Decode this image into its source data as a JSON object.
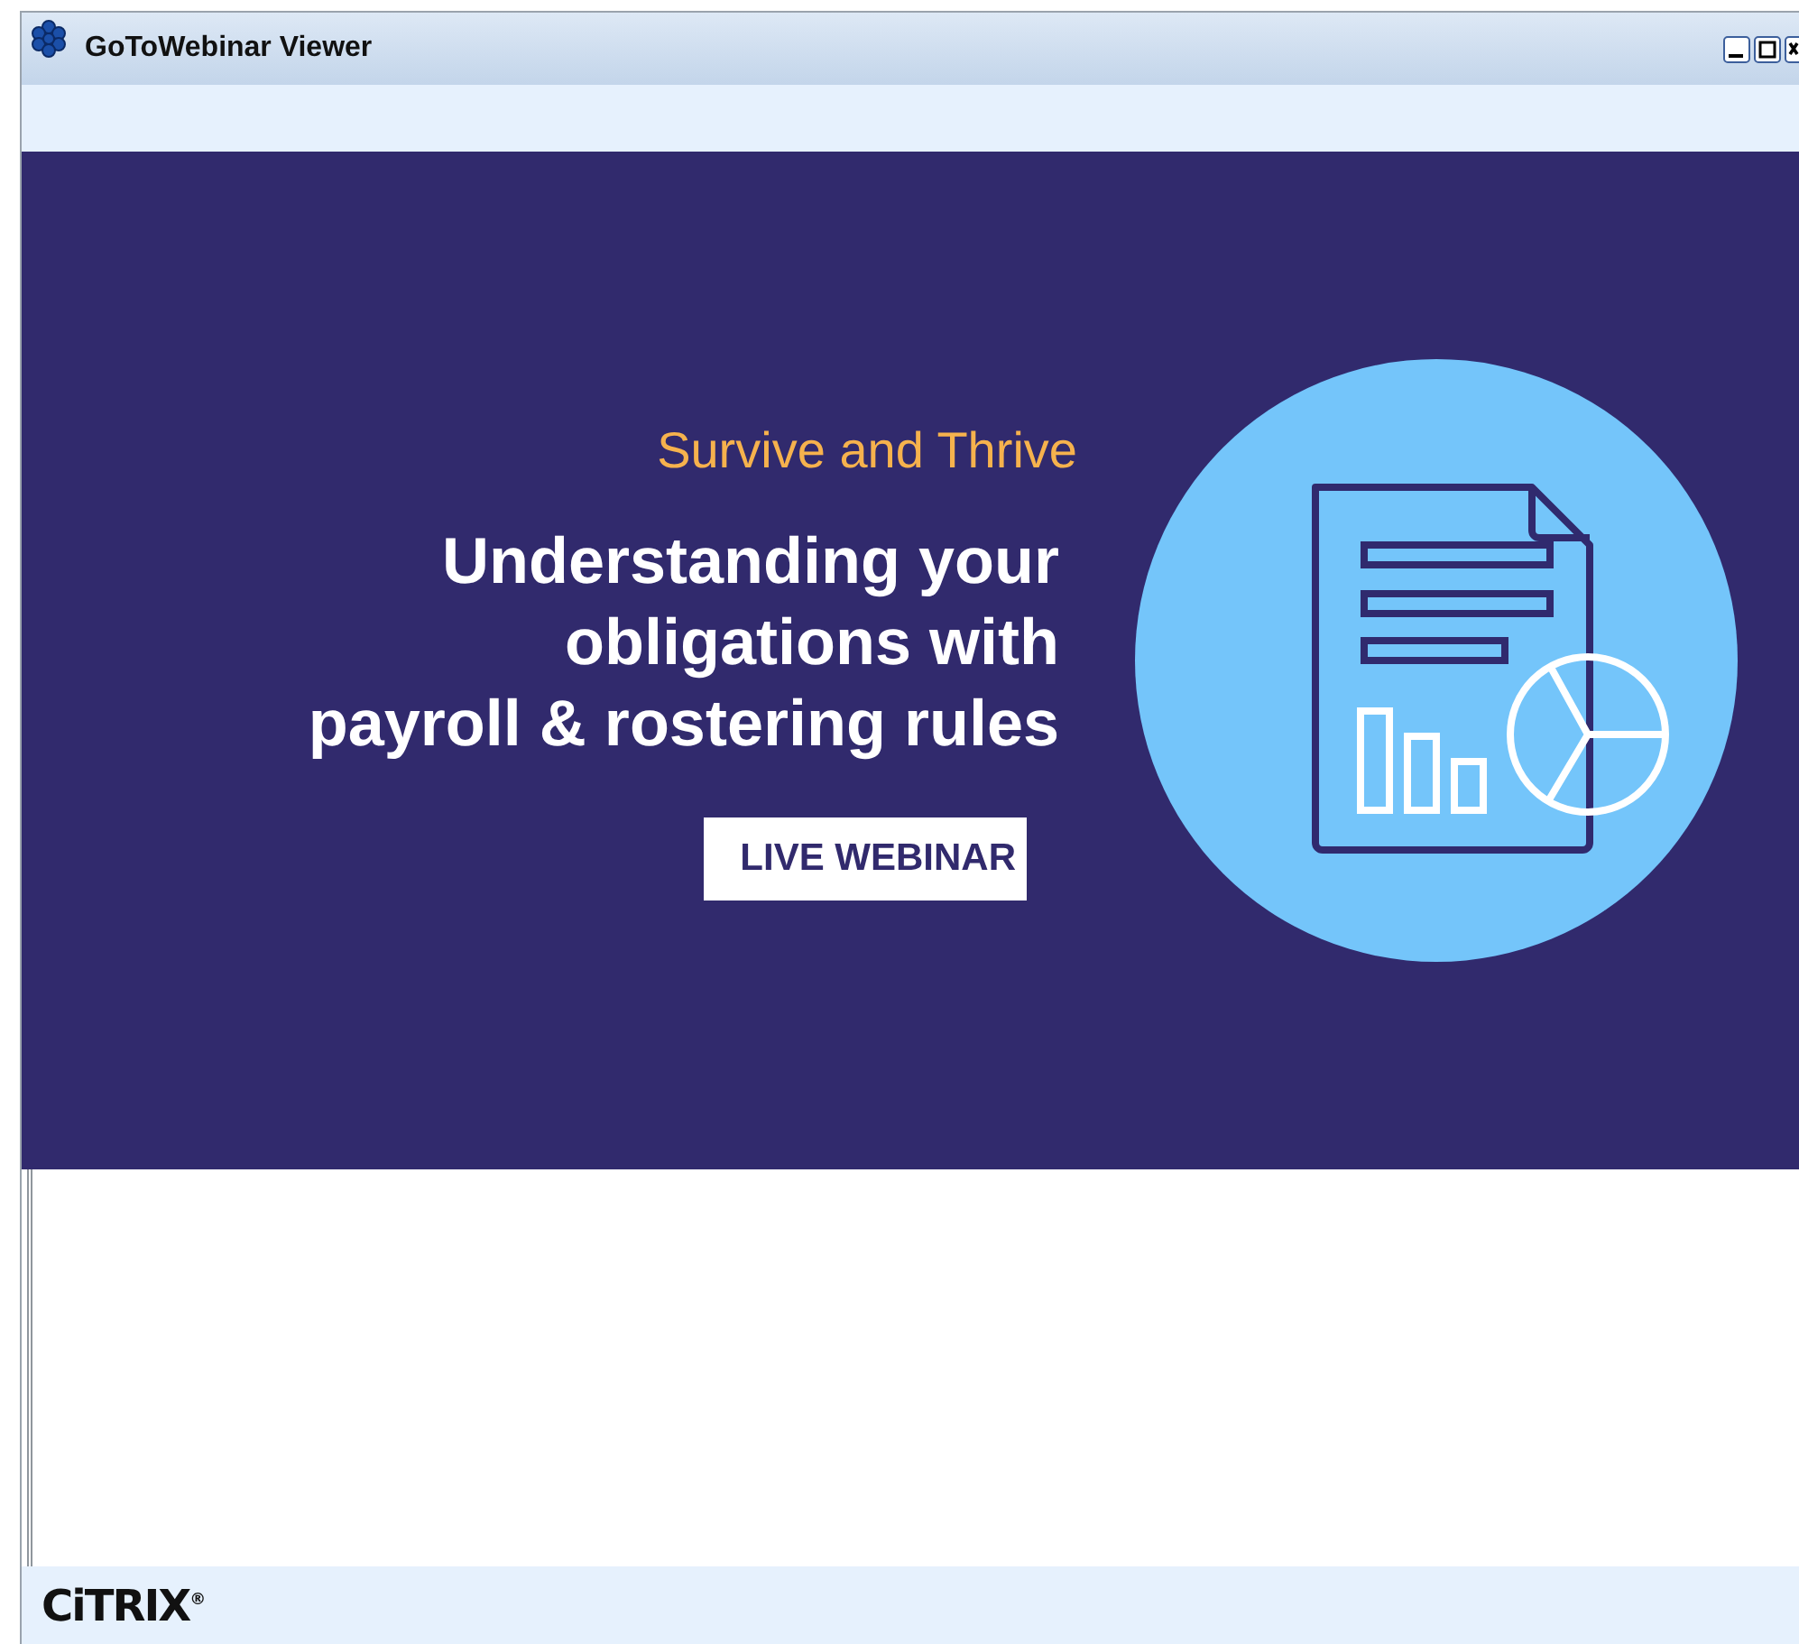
{
  "window": {
    "title": "GoToWebinar Viewer"
  },
  "slide": {
    "subtitle": "Survive and Thrive",
    "title_lines": [
      "Understanding your",
      "obligations with",
      "payroll & rostering rules"
    ],
    "button": "LIVE WEBINAR"
  },
  "footer": {
    "logo": "CiTRIX$^{®}$"
  }
}
